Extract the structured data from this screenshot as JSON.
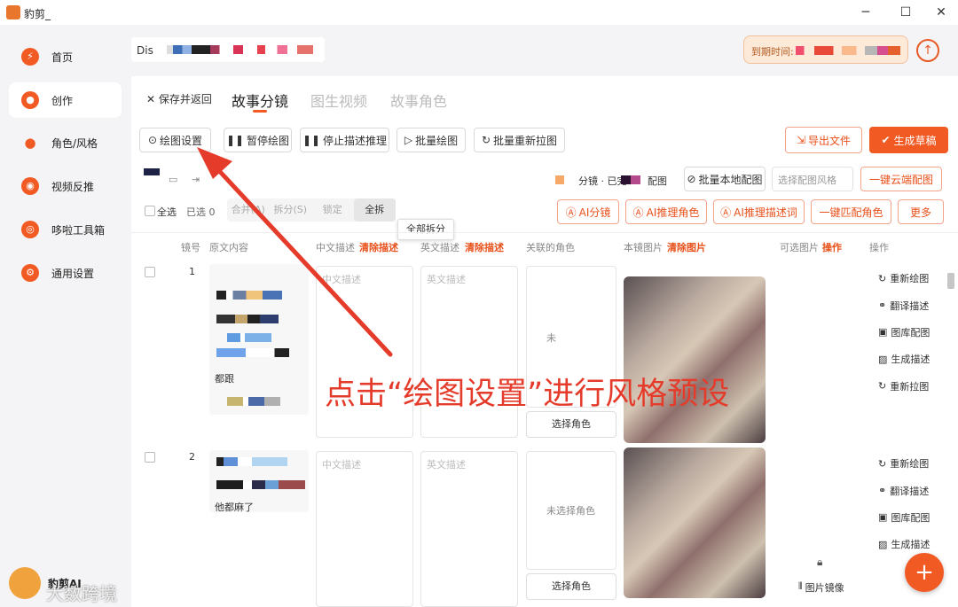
{
  "window": {
    "title": "豹剪_",
    "minimize": "─",
    "maximize": "☐",
    "close": "✕"
  },
  "sidebar": {
    "items": [
      {
        "label": "首页",
        "icon": "lightning-icon"
      },
      {
        "label": "创作",
        "icon": "palette-icon"
      },
      {
        "label": "角色/风格",
        "icon": "user-icon"
      },
      {
        "label": "视频反推",
        "icon": "aperture-icon"
      },
      {
        "label": "哆啦工具箱",
        "icon": "eye-icon"
      },
      {
        "label": "通用设置",
        "icon": "gear-icon"
      }
    ],
    "brand": "豹剪AI"
  },
  "header": {
    "discord_label": "Dis",
    "expire_label": "到期时间:",
    "upload_icon": "↑"
  },
  "tabs": {
    "save_back": "✕ 保存并返回",
    "items": [
      "故事分镜",
      "图生视频",
      "故事角色"
    ],
    "active": 0
  },
  "toolbar": {
    "draw_settings": "绘图设置",
    "pause_draw": "暂停绘图",
    "stop_reason": "停止描述推理",
    "batch_draw": "批量绘图",
    "batch_redraw": "批量重新拉图",
    "export_file": "导出文件",
    "generate_draft": "生成草稿"
  },
  "toolbar2": {
    "status_text": "分镜 · 已完",
    "status_suffix": "配图",
    "batch_local": "批量本地配图",
    "style_placeholder": "选择配图风格",
    "cloud_match": "一键云端配图"
  },
  "toolbar3": {
    "select_all": "全选",
    "selected": "已选 0",
    "segments": [
      "合并(A)",
      "拆分(S)",
      "锁定",
      "全拆"
    ],
    "tooltip": "全部拆分",
    "ai_split": "AI分镜",
    "ai_roles": "AI推理角色",
    "ai_desc": "AI推理描述词",
    "match_roles": "一键匹配角色",
    "more": "更多"
  },
  "table": {
    "headers": {
      "index": "镜号",
      "source": "原文内容",
      "cn": "中文描述",
      "cn_clear": "清除描述",
      "en": "英文描述",
      "en_clear": "清除描述",
      "role": "关联的角色",
      "image": "本镜图片",
      "image_clear": "清除图片",
      "optional": "可选图片",
      "optional_op": "操作",
      "ops": "操作"
    },
    "rows": [
      {
        "index": "1",
        "cn_ph": "中文描述",
        "en_ph": "英文描述",
        "role": "未",
        "role_btn": "选择角色",
        "source_frag": "都跟"
      },
      {
        "index": "2",
        "cn_ph": "中文描述",
        "en_ph": "英文描述",
        "role": "未选择角色",
        "role_btn": "选择角色",
        "source_frag": "他都麻了"
      }
    ],
    "ops": [
      "重新绘图",
      "翻译描述",
      "图库配图",
      "生成描述",
      "重新拉图"
    ],
    "mirror": "图片镜像"
  },
  "annotation": "点击“绘图设置”进行风格预设",
  "watermark": "大数跨境",
  "colors": {
    "accent": "#f25a24",
    "annotation": "#e53b2a"
  }
}
